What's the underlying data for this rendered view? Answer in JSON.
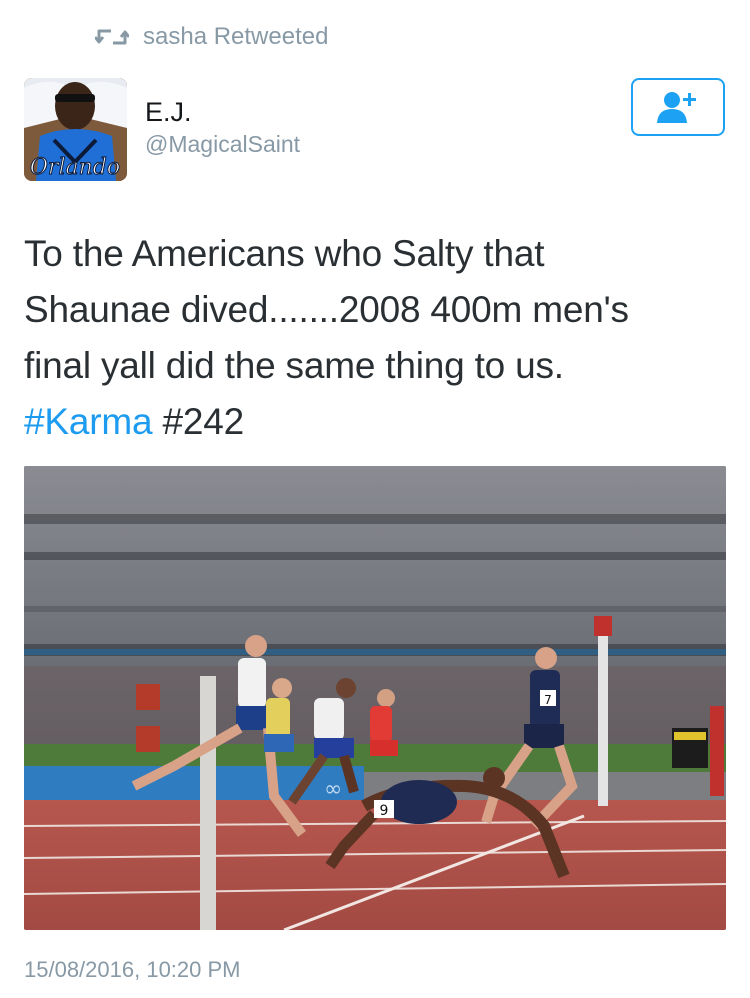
{
  "retweet": {
    "icon": "retweet-icon",
    "label": "sasha Retweeted"
  },
  "author": {
    "name": "E.J.",
    "handle": "@MagicalSaint",
    "avatar_jersey_text": "Orlando"
  },
  "follow_button": {
    "icon": "add-user-icon"
  },
  "tweet": {
    "lines": [
      "To the Americans who Salty that",
      "Shaunae dived.......2008 400m men's",
      "final yall did the same thing to us."
    ],
    "hashtags": [
      "#Karma",
      "#242"
    ]
  },
  "media": {
    "image": "race-finish-photo",
    "bib_number": "9",
    "bib_number_2": "7"
  },
  "meta": {
    "timestamp": "15/08/2016, 10:20 PM"
  },
  "colors": {
    "accent": "#1da1f2",
    "muted": "#8899a6",
    "text": "#292f33"
  }
}
